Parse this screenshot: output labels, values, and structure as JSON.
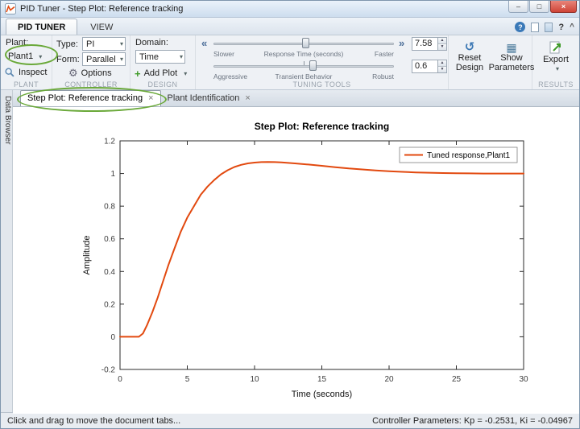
{
  "colors": {
    "annotation": "#69a838",
    "curve": "#e2490f",
    "close": "#cf4437",
    "help": "#3a79b8"
  },
  "icons": {
    "dropdown": "▾",
    "spin_up": "▲",
    "spin_down": "▼",
    "chevron_left": "«",
    "chevron_right": "»",
    "minimize": "–",
    "maximize": "□",
    "close": "×",
    "tab_close": "×",
    "gear": "⚙",
    "plus": "+",
    "undo": "↺",
    "table": "▦",
    "help": "?",
    "collapse": "^"
  },
  "window": {
    "title": "PID Tuner - Step Plot: Reference tracking"
  },
  "toolstrip": {
    "tabs": [
      {
        "label": "PID TUNER"
      },
      {
        "label": "VIEW"
      }
    ],
    "plant": {
      "section": "PLANT",
      "label": "Plant:",
      "value": "Plant1",
      "inspect": "Inspect"
    },
    "controller": {
      "section": "CONTROLLER",
      "type_label": "Type:",
      "type_value": "PI",
      "form_label": "Form:",
      "form_value": "Parallel",
      "options": "Options"
    },
    "design": {
      "section": "DESIGN",
      "domain_label": "Domain:",
      "domain_value": "Time",
      "add_plot": "Add Plot"
    },
    "tuning": {
      "section": "TUNING TOOLS",
      "response": {
        "left": "Slower",
        "title": "Response Time (seconds)",
        "right": "Faster",
        "value": "7.58",
        "position_pct": 51
      },
      "transient": {
        "left": "Aggressive",
        "title": "Transient Behavior",
        "right": "Robust",
        "value": "0.6",
        "position_pct": 55
      }
    },
    "actions": {
      "reset_line1": "Reset",
      "reset_line2": "Design",
      "show_line1": "Show",
      "show_line2": "Parameters"
    },
    "results": {
      "section": "RESULTS",
      "export": "Export"
    }
  },
  "data_browser": {
    "label": "Data Browser"
  },
  "document_tabs": [
    {
      "label": "Step Plot: Reference tracking"
    },
    {
      "label": "Plant Identification"
    }
  ],
  "status_bar": {
    "left": "Click and drag to move the document tabs...",
    "right": "Controller Parameters: Kp = -0.2531, Ki = -0.04967"
  },
  "chart_data": {
    "type": "line",
    "title": "Step Plot: Reference tracking",
    "xlabel": "Time (seconds)",
    "ylabel": "Amplitude",
    "xlim": [
      0,
      30
    ],
    "ylim": [
      -0.2,
      1.2
    ],
    "xticks": [
      0,
      5,
      10,
      15,
      20,
      25,
      30
    ],
    "yticks": [
      -0.2,
      0,
      0.2,
      0.4,
      0.6,
      0.8,
      1,
      1.2
    ],
    "grid": false,
    "legend_position": "top-right",
    "legend": [
      "Tuned response,Plant1"
    ],
    "series": [
      {
        "name": "Tuned response,Plant1",
        "color": "#e2490f",
        "x": [
          0,
          1.4,
          1.7,
          2,
          2.4,
          2.8,
          3.2,
          3.6,
          4,
          4.5,
          5,
          5.5,
          6,
          6.5,
          7,
          7.5,
          8,
          8.5,
          9,
          9.5,
          10,
          10.5,
          11,
          11.5,
          12,
          13,
          14,
          15,
          16,
          17,
          18,
          19,
          20,
          21,
          22,
          23,
          24,
          25,
          26,
          27,
          28,
          29,
          30
        ],
        "y": [
          0,
          0,
          0.02,
          0.07,
          0.15,
          0.24,
          0.34,
          0.44,
          0.53,
          0.64,
          0.73,
          0.8,
          0.87,
          0.92,
          0.96,
          0.995,
          1.02,
          1.04,
          1.053,
          1.062,
          1.067,
          1.07,
          1.071,
          1.07,
          1.068,
          1.062,
          1.055,
          1.047,
          1.039,
          1.031,
          1.025,
          1.019,
          1.014,
          1.01,
          1.007,
          1.005,
          1.003,
          1.002,
          1.001,
          1,
          1,
          1,
          1
        ]
      }
    ]
  }
}
